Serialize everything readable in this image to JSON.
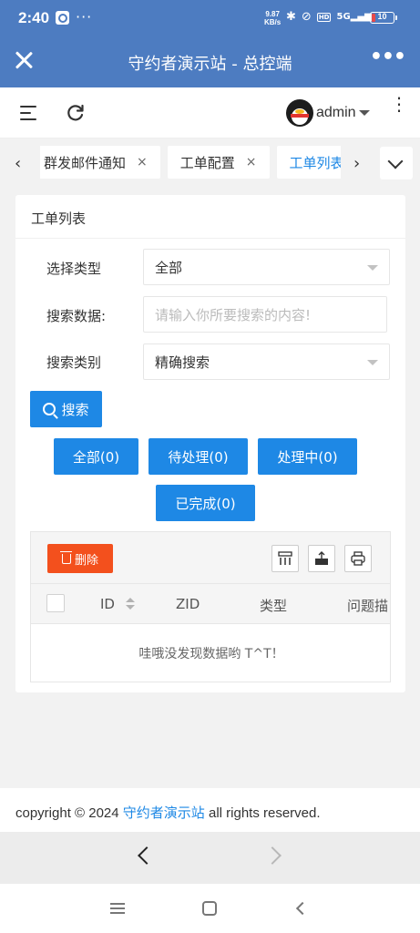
{
  "status_bar": {
    "time": "2:40",
    "more": "···",
    "net_speed_value": "9.87",
    "net_speed_unit": "KB/s",
    "hd": "HD",
    "signal": "5G",
    "battery": "10",
    "battery_color": "#e84a4a"
  },
  "titlebar": {
    "title": "守约者演示站 - 总控端",
    "more": "•••"
  },
  "header": {
    "username": "admin",
    "kebab": "⋮"
  },
  "tabs": {
    "items": [
      {
        "label": "群发邮件通知",
        "closable": true
      },
      {
        "label": "工单配置",
        "closable": true
      },
      {
        "label": "工单列表",
        "closable": false,
        "active": true
      }
    ],
    "close_glyph": "×",
    "prev": "‹",
    "next": "›"
  },
  "card": {
    "title": "工单列表",
    "filters": {
      "type_label": "选择类型",
      "type_value": "全部",
      "data_label": "搜索数据:",
      "data_placeholder": "请输入你所要搜索的内容!",
      "mode_label": "搜索类别",
      "mode_value": "精确搜索"
    },
    "search_button": "搜索",
    "status_buttons": [
      "全部(0)",
      "待处理(0)",
      "处理中(0)",
      "已完成(0)"
    ]
  },
  "table": {
    "delete_button": "删除",
    "columns": [
      "ID",
      "ZID",
      "类型",
      "问题描"
    ],
    "empty_text": "哇哦没发现数据哟 T^T！",
    "toolbar_icons": [
      "columns-icon",
      "export-icon",
      "print-icon"
    ]
  },
  "footer": {
    "prefix": "copyright © 2024 ",
    "site": "守约者演示站",
    "suffix": " all rights reserved."
  },
  "colors": {
    "primary": "#1e88e5",
    "danger": "#f3501d",
    "header_blue": "#4d7cc1"
  }
}
